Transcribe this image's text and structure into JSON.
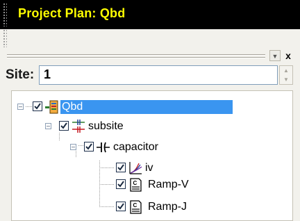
{
  "window": {
    "title": "Project Plan: Qbd"
  },
  "site": {
    "label": "Site:",
    "value": "1"
  },
  "dock": {
    "minimize_glyph": "▼",
    "close_glyph": "x"
  },
  "tree": {
    "nodes": [
      {
        "label": "Qbd",
        "checked": true,
        "expanded": true,
        "selected": true,
        "icon": "project-icon"
      },
      {
        "label": "subsite",
        "checked": true,
        "expanded": true,
        "icon": "subsite-icon"
      },
      {
        "label": "capacitor",
        "checked": true,
        "expanded": true,
        "icon": "capacitor-icon"
      },
      {
        "label": "iv",
        "checked": true,
        "icon": "iv-plot-icon"
      },
      {
        "label": "Ramp-V",
        "checked": true,
        "icon": "test-script-icon"
      },
      {
        "label": "Ramp-J",
        "checked": true,
        "icon": "test-script-icon"
      }
    ]
  },
  "colors": {
    "title_bg": "#000000",
    "title_fg": "#ffff00",
    "selection": "#3a95f0"
  }
}
